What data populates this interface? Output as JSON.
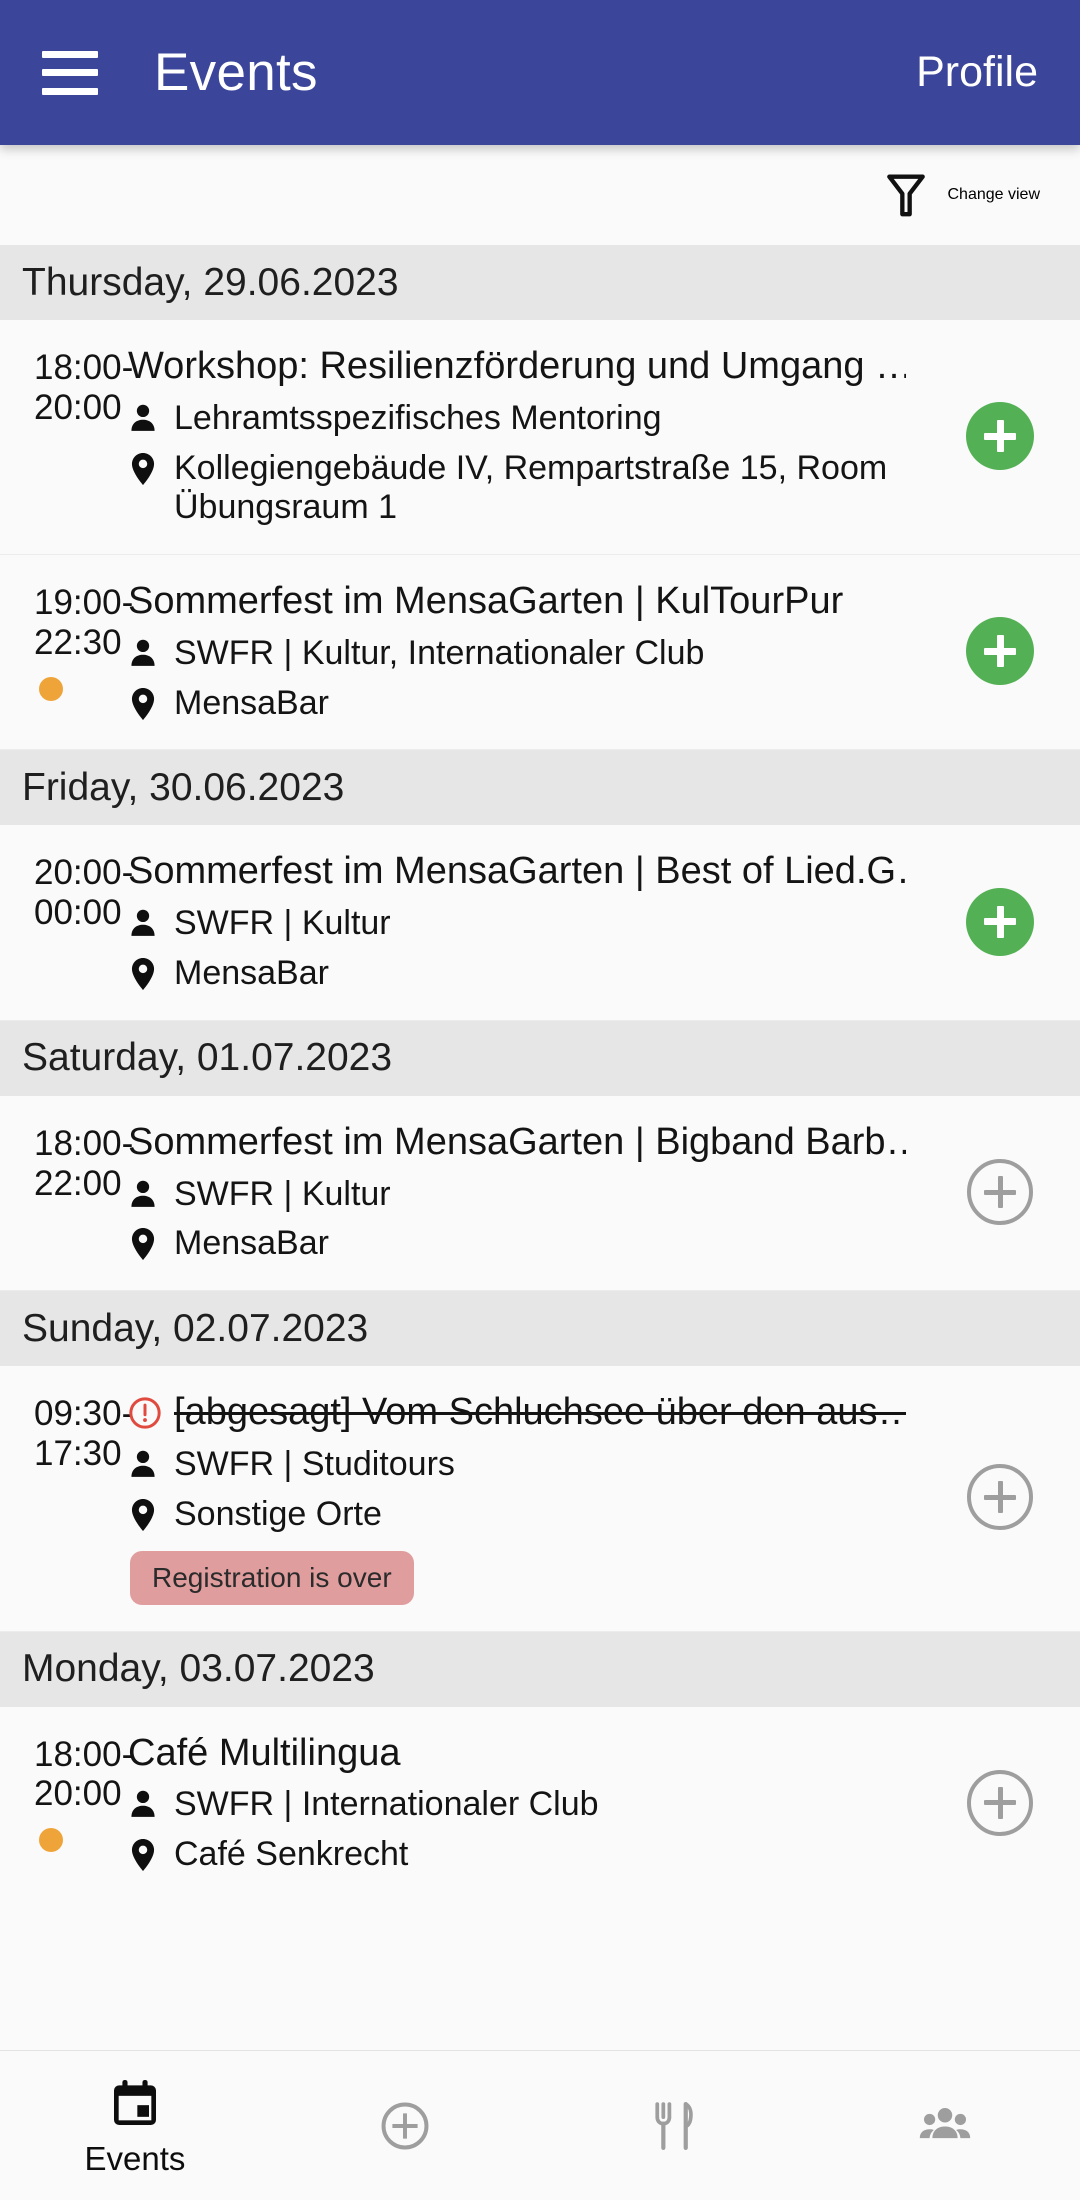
{
  "appbar": {
    "menu_icon": "hamburger-menu-icon",
    "title": "Events",
    "profile_label": "Profile",
    "background_color": "#3b4599",
    "text_color": "#ffffff"
  },
  "viewbar": {
    "filter_icon": "funnel-filter-icon",
    "label": "Change view"
  },
  "colors": {
    "accent_green": "#54b055",
    "dot_orange": "#efa43a",
    "badge_red": "#e09d9d",
    "alert_red": "#e53935",
    "day_header_bg": "#e6e6e6",
    "outline_gray": "#9e9e9e"
  },
  "days": [
    {
      "header": "Thursday, 29.06.2023",
      "events": [
        {
          "time_start": "18:00-",
          "time_end": "20:00",
          "dot": false,
          "cancelled": false,
          "title": "Workshop: Resilienzförderung und Umgang …",
          "organizer_icon": "person-icon",
          "organizer": "Lehramtsspezifisches Mentoring",
          "location_icon": "map-pin-icon",
          "location": "Kollegiengebäude IV, Rempartstraße 15, Room Übungsraum 1",
          "badge": null,
          "action": "add-filled"
        },
        {
          "time_start": "19:00-",
          "time_end": "22:30",
          "dot": true,
          "cancelled": false,
          "title": "Sommerfest im MensaGarten | KulTourPur",
          "organizer_icon": "person-icon",
          "organizer": "SWFR | Kultur, Internationaler Club",
          "location_icon": "map-pin-icon",
          "location": "MensaBar",
          "badge": null,
          "action": "add-filled"
        }
      ]
    },
    {
      "header": "Friday, 30.06.2023",
      "events": [
        {
          "time_start": "20:00-",
          "time_end": "00:00",
          "dot": false,
          "cancelled": false,
          "title": "Sommerfest im MensaGarten | Best of Lied.G…",
          "organizer_icon": "person-icon",
          "organizer": "SWFR | Kultur",
          "location_icon": "map-pin-icon",
          "location": "MensaBar",
          "badge": null,
          "action": "add-filled"
        }
      ]
    },
    {
      "header": "Saturday, 01.07.2023",
      "events": [
        {
          "time_start": "18:00-",
          "time_end": "22:00",
          "dot": false,
          "cancelled": false,
          "title": "Sommerfest im MensaGarten | Bigband Barb…",
          "organizer_icon": "person-icon",
          "organizer": "SWFR | Kultur",
          "location_icon": "map-pin-icon",
          "location": "MensaBar",
          "badge": null,
          "action": "add-outline"
        }
      ]
    },
    {
      "header": "Sunday, 02.07.2023",
      "events": [
        {
          "time_start": "09:30-",
          "time_end": "17:30",
          "dot": false,
          "cancelled": true,
          "alert_icon": "alert-circle-icon",
          "title": "[abgesagt] Vom Schluchsee über den aus…",
          "organizer_icon": "person-icon",
          "organizer": "SWFR | Studitours",
          "location_icon": "map-pin-icon",
          "location": "Sonstige Orte",
          "badge": "Registration is over",
          "action": "add-outline"
        }
      ]
    },
    {
      "header": "Monday, 03.07.2023",
      "events": [
        {
          "time_start": "18:00-",
          "time_end": "20:00",
          "dot": true,
          "cancelled": false,
          "title": "Café Multilingua",
          "organizer_icon": "person-icon",
          "organizer": "SWFR | Internationaler Club",
          "location_icon": "map-pin-icon",
          "location": "Café Senkrecht",
          "badge": null,
          "action": "add-outline"
        }
      ]
    }
  ],
  "bottomnav": [
    {
      "icon": "calendar-icon",
      "label": "Events",
      "active": true
    },
    {
      "icon": "plus-circle-icon",
      "label": "",
      "active": false
    },
    {
      "icon": "restaurant-icon",
      "label": "",
      "active": false
    },
    {
      "icon": "people-icon",
      "label": "",
      "active": false
    }
  ]
}
